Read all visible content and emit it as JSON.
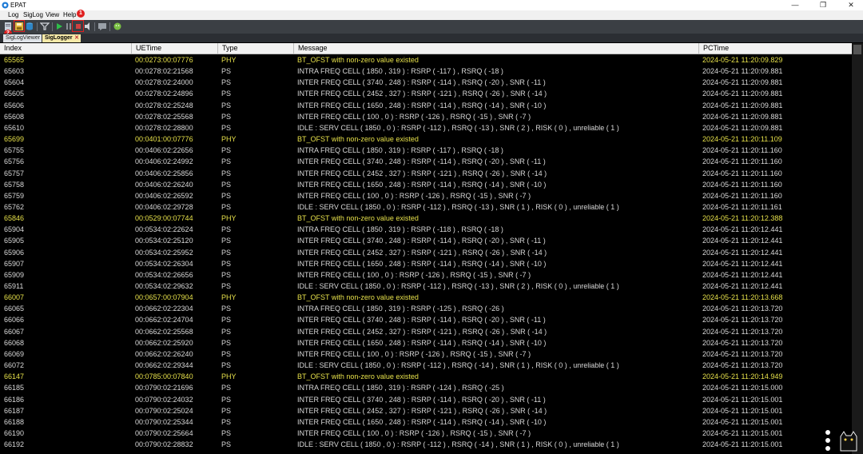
{
  "app": {
    "title": "EPAT"
  },
  "menu": [
    "Log",
    "SigLog",
    "View",
    "Help"
  ],
  "annotations": {
    "badge1": "1",
    "badge2": "2"
  },
  "tabs": [
    {
      "label": "SigLogViewer",
      "active": false
    },
    {
      "label": "SigLogger",
      "active": true,
      "close": "✕"
    }
  ],
  "columns": [
    "Index",
    "UETime",
    "Type",
    "Message",
    "PCTime"
  ],
  "colors": {
    "phy_row": "#e6e04a",
    "ps_row": "#d9d9d9",
    "background": "#000000"
  },
  "rows": [
    [
      "65565",
      "00:0273:00:07776",
      "PHY",
      "BT_OFST with non-zero value existed",
      "2024-05-21 11:20:09.829"
    ],
    [
      "65603",
      "00:0278:02:21568",
      "PS",
      "INTRA FREQ CELL ( 1850 , 319 ) : RSRP ( -117 ) , RSRQ ( -18 )",
      "2024-05-21 11:20:09.881"
    ],
    [
      "65604",
      "00:0278:02:24000",
      "PS",
      "INTER FREQ CELL ( 3740 , 248 ) : RSRP ( -114 ) , RSRQ ( -20 ) , SNR ( -11 )",
      "2024-05-21 11:20:09.881"
    ],
    [
      "65605",
      "00:0278:02:24896",
      "PS",
      "INTER FREQ CELL ( 2452 , 327 ) : RSRP ( -121 ) , RSRQ ( -26 ) , SNR ( -14 )",
      "2024-05-21 11:20:09.881"
    ],
    [
      "65606",
      "00:0278:02:25248",
      "PS",
      "INTER FREQ CELL ( 1650 , 248 ) : RSRP ( -114 ) , RSRQ ( -14 ) , SNR ( -10 )",
      "2024-05-21 11:20:09.881"
    ],
    [
      "65608",
      "00:0278:02:25568",
      "PS",
      "INTER FREQ CELL ( 100 , 0 ) : RSRP ( -126 ) , RSRQ ( -15 ) , SNR ( -7 )",
      "2024-05-21 11:20:09.881"
    ],
    [
      "65610",
      "00:0278:02:28800",
      "PS",
      "IDLE : SERV CELL ( 1850 , 0 ) : RSRP ( -112 ) , RSRQ ( -13 ) , SNR ( 2 ) , RISK ( 0 ) , unreliable ( 1 )",
      "2024-05-21 11:20:09.881"
    ],
    [
      "65699",
      "00:0401:00:07776",
      "PHY",
      "BT_OFST with non-zero value existed",
      "2024-05-21 11:20:11.109"
    ],
    [
      "65755",
      "00:0406:02:22656",
      "PS",
      "INTRA FREQ CELL ( 1850 , 319 ) : RSRP ( -117 ) , RSRQ ( -18 )",
      "2024-05-21 11:20:11.160"
    ],
    [
      "65756",
      "00:0406:02:24992",
      "PS",
      "INTER FREQ CELL ( 3740 , 248 ) : RSRP ( -114 ) , RSRQ ( -20 ) , SNR ( -11 )",
      "2024-05-21 11:20:11.160"
    ],
    [
      "65757",
      "00:0406:02:25856",
      "PS",
      "INTER FREQ CELL ( 2452 , 327 ) : RSRP ( -121 ) , RSRQ ( -26 ) , SNR ( -14 )",
      "2024-05-21 11:20:11.160"
    ],
    [
      "65758",
      "00:0406:02:26240",
      "PS",
      "INTER FREQ CELL ( 1650 , 248 ) : RSRP ( -114 ) , RSRQ ( -14 ) , SNR ( -10 )",
      "2024-05-21 11:20:11.160"
    ],
    [
      "65759",
      "00:0406:02:26592",
      "PS",
      "INTER FREQ CELL ( 100 , 0 ) : RSRP ( -126 ) , RSRQ ( -15 ) , SNR ( -7 )",
      "2024-05-21 11:20:11.160"
    ],
    [
      "65762",
      "00:0406:02:29728",
      "PS",
      "IDLE : SERV CELL ( 1850 , 0 ) : RSRP ( -112 ) , RSRQ ( -13 ) , SNR ( 1 ) , RISK ( 0 ) , unreliable ( 1 )",
      "2024-05-21 11:20:11.161"
    ],
    [
      "65846",
      "00:0529:00:07744",
      "PHY",
      "BT_OFST with non-zero value existed",
      "2024-05-21 11:20:12.388"
    ],
    [
      "65904",
      "00:0534:02:22624",
      "PS",
      "INTRA FREQ CELL ( 1850 , 319 ) : RSRP ( -118 ) , RSRQ ( -18 )",
      "2024-05-21 11:20:12.441"
    ],
    [
      "65905",
      "00:0534:02:25120",
      "PS",
      "INTER FREQ CELL ( 3740 , 248 ) : RSRP ( -114 ) , RSRQ ( -20 ) , SNR ( -11 )",
      "2024-05-21 11:20:12.441"
    ],
    [
      "65906",
      "00:0534:02:25952",
      "PS",
      "INTER FREQ CELL ( 2452 , 327 ) : RSRP ( -121 ) , RSRQ ( -26 ) , SNR ( -14 )",
      "2024-05-21 11:20:12.441"
    ],
    [
      "65907",
      "00:0534:02:26304",
      "PS",
      "INTER FREQ CELL ( 1650 , 248 ) : RSRP ( -114 ) , RSRQ ( -14 ) , SNR ( -10 )",
      "2024-05-21 11:20:12.441"
    ],
    [
      "65909",
      "00:0534:02:26656",
      "PS",
      "INTER FREQ CELL ( 100 , 0 ) : RSRP ( -126 ) , RSRQ ( -15 ) , SNR ( -7 )",
      "2024-05-21 11:20:12.441"
    ],
    [
      "65911",
      "00:0534:02:29632",
      "PS",
      "IDLE : SERV CELL ( 1850 , 0 ) : RSRP ( -112 ) , RSRQ ( -13 ) , SNR ( 2 ) , RISK ( 0 ) , unreliable ( 1 )",
      "2024-05-21 11:20:12.441"
    ],
    [
      "66007",
      "00:0657:00:07904",
      "PHY",
      "BT_OFST with non-zero value existed",
      "2024-05-21 11:20:13.668"
    ],
    [
      "66065",
      "00:0662:02:22304",
      "PS",
      "INTRA FREQ CELL ( 1850 , 319 ) : RSRP ( -125 ) , RSRQ ( -26 )",
      "2024-05-21 11:20:13.720"
    ],
    [
      "66066",
      "00:0662:02:24704",
      "PS",
      "INTER FREQ CELL ( 3740 , 248 ) : RSRP ( -114 ) , RSRQ ( -20 ) , SNR ( -11 )",
      "2024-05-21 11:20:13.720"
    ],
    [
      "66067",
      "00:0662:02:25568",
      "PS",
      "INTER FREQ CELL ( 2452 , 327 ) : RSRP ( -121 ) , RSRQ ( -26 ) , SNR ( -14 )",
      "2024-05-21 11:20:13.720"
    ],
    [
      "66068",
      "00:0662:02:25920",
      "PS",
      "INTER FREQ CELL ( 1650 , 248 ) : RSRP ( -114 ) , RSRQ ( -14 ) , SNR ( -10 )",
      "2024-05-21 11:20:13.720"
    ],
    [
      "66069",
      "00:0662:02:26240",
      "PS",
      "INTER FREQ CELL ( 100 , 0 ) : RSRP ( -126 ) , RSRQ ( -15 ) , SNR ( -7 )",
      "2024-05-21 11:20:13.720"
    ],
    [
      "66072",
      "00:0662:02:29344",
      "PS",
      "IDLE : SERV CELL ( 1850 , 0 ) : RSRP ( -112 ) , RSRQ ( -14 ) , SNR ( 1 ) , RISK ( 0 ) , unreliable ( 1 )",
      "2024-05-21 11:20:13.720"
    ],
    [
      "66147",
      "00:0785:00:07840",
      "PHY",
      "BT_OFST with non-zero value existed",
      "2024-05-21 11:20:14.949"
    ],
    [
      "66185",
      "00:0790:02:21696",
      "PS",
      "INTRA FREQ CELL ( 1850 , 319 ) : RSRP ( -124 ) , RSRQ ( -25 )",
      "2024-05-21 11:20:15.000"
    ],
    [
      "66186",
      "00:0790:02:24032",
      "PS",
      "INTER FREQ CELL ( 3740 , 248 ) : RSRP ( -114 ) , RSRQ ( -20 ) , SNR ( -11 )",
      "2024-05-21 11:20:15.001"
    ],
    [
      "66187",
      "00:0790:02:25024",
      "PS",
      "INTER FREQ CELL ( 2452 , 327 ) : RSRP ( -121 ) , RSRQ ( -26 ) , SNR ( -14 )",
      "2024-05-21 11:20:15.001"
    ],
    [
      "66188",
      "00:0790:02:25344",
      "PS",
      "INTER FREQ CELL ( 1650 , 248 ) : RSRP ( -114 ) , RSRQ ( -14 ) , SNR ( -10 )",
      "2024-05-21 11:20:15.001"
    ],
    [
      "66190",
      "00:0790:02:25664",
      "PS",
      "INTER FREQ CELL ( 100 , 0 ) : RSRP ( -126 ) , RSRQ ( -15 ) , SNR ( -7 )",
      "2024-05-21 11:20:15.001"
    ],
    [
      "66192",
      "00:0790:02:28832",
      "PS",
      "IDLE : SERV CELL ( 1850 , 0 ) : RSRP ( -112 ) , RSRQ ( -14 ) , SNR ( 1 ) , RISK ( 0 ) , unreliable ( 1 )",
      "2024-05-21 11:20:15.001"
    ]
  ]
}
